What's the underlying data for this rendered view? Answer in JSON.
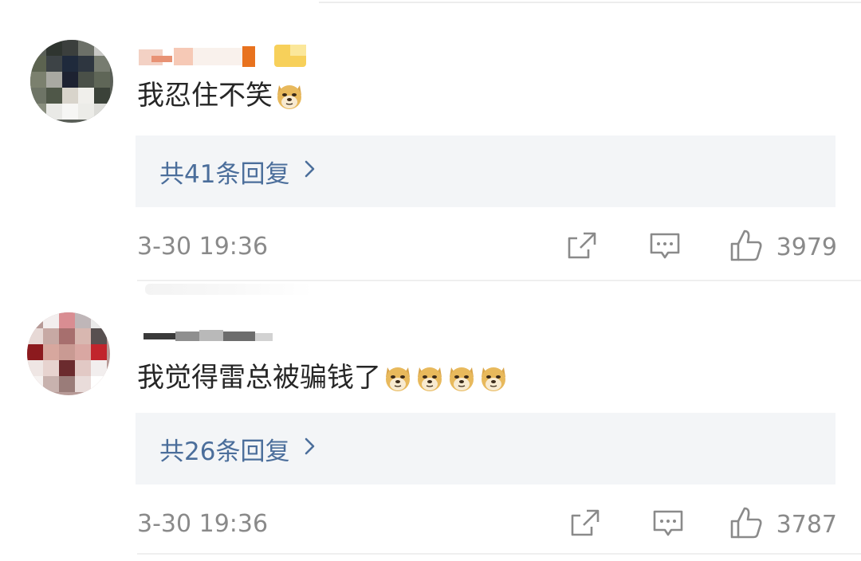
{
  "comments": [
    {
      "text": "我忍住不笑",
      "emojis": [
        "doge-emoji"
      ],
      "replies_label": "共41条回复",
      "time": "3-30 19:36",
      "likes": "3979"
    },
    {
      "text": "我觉得雷总被骗钱了",
      "emojis": [
        "doge-emoji",
        "doge-emoji",
        "doge-emoji",
        "doge-emoji"
      ],
      "replies_label": "共26条回复",
      "time": "3-30 19:36",
      "likes": "3787"
    }
  ],
  "colors": {
    "link": "#4b6e9b",
    "reply_bg": "#f3f5f7",
    "meta_text": "#8a8a8a"
  },
  "icons": {
    "share": "share-icon",
    "comment": "comment-icon",
    "like": "thumbs-up-icon",
    "chevron": "chevron-right-icon"
  }
}
